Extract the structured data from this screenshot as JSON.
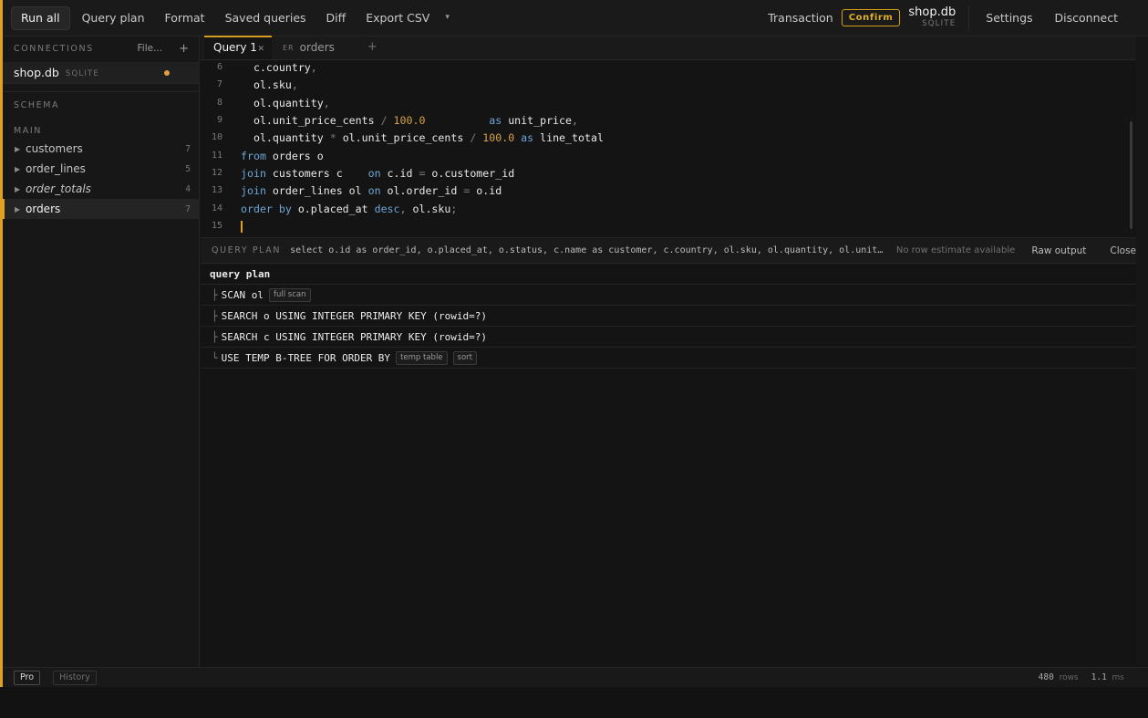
{
  "toolbar": {
    "run_all": "Run all",
    "query_plan": "Query plan",
    "format": "Format",
    "saved_queries": "Saved queries",
    "diff": "Diff",
    "export_csv": "Export CSV",
    "transaction": "Transaction",
    "confirm": "Confirm",
    "db_name": "shop.db",
    "db_kind": "SQLITE",
    "settings": "Settings",
    "disconnect": "Disconnect"
  },
  "sidebar": {
    "connections_label": "CONNECTIONS",
    "file_button": "File...",
    "add_button": "+",
    "connection": {
      "name": "shop.db",
      "kind": "SQLITE"
    },
    "schema_label": "SCHEMA",
    "main_label": "MAIN",
    "tables": [
      {
        "name": "customers",
        "count": "7"
      },
      {
        "name": "order_lines",
        "count": "5"
      },
      {
        "name": "order_totals",
        "count": "4"
      },
      {
        "name": "orders",
        "count": "7"
      }
    ]
  },
  "tabs": {
    "query_tab": "Query 1",
    "er_prefix": "ER",
    "er_tab": "orders",
    "add": "+"
  },
  "editor": {
    "line_numbers": [
      "6",
      "7",
      "8",
      "9",
      "10",
      "11",
      "12",
      "13",
      "14",
      "15"
    ],
    "lines": [
      "c.country,",
      "ol.sku,",
      "ol.quantity,",
      "ol.unit_price_cents / 100.0 as unit_price,",
      "ol.quantity * ol.unit_price_cents / 100.0 as line_total",
      "from orders o",
      "join customers c on c.id = o.customer_id",
      "join order_lines ol on ol.order_id = o.id",
      "order by o.placed_at desc, ol.sku;",
      ""
    ]
  },
  "query_plan_bar": {
    "label": "QUERY PLAN",
    "sql": "select o.id as order_id, o.placed_at, o.status, c.name as customer, c.country, ol.sku, ol.quantity, ol.unit_price_cents…",
    "no_estimate": "No row estimate available",
    "raw_output": "Raw output",
    "close": "Close"
  },
  "plan": {
    "header": "query plan",
    "rows": [
      {
        "prefix": "├",
        "text": "SCAN ol",
        "tags": [
          "full scan"
        ]
      },
      {
        "prefix": "├",
        "text": "SEARCH o USING INTEGER PRIMARY KEY (rowid=?)",
        "tags": []
      },
      {
        "prefix": "├",
        "text": "SEARCH c USING INTEGER PRIMARY KEY (rowid=?)",
        "tags": []
      },
      {
        "prefix": "└",
        "text": "USE TEMP B-TREE FOR ORDER BY",
        "tags": [
          "temp table",
          "sort"
        ]
      }
    ]
  },
  "status": {
    "pro": "Pro",
    "history": "History",
    "rows_value": "480",
    "rows_unit": "rows",
    "ms_value": "1.1",
    "ms_unit": "ms"
  },
  "colors": {
    "accent": "#e0a020",
    "keyword": "#6da6d6",
    "number": "#d6a24a"
  }
}
